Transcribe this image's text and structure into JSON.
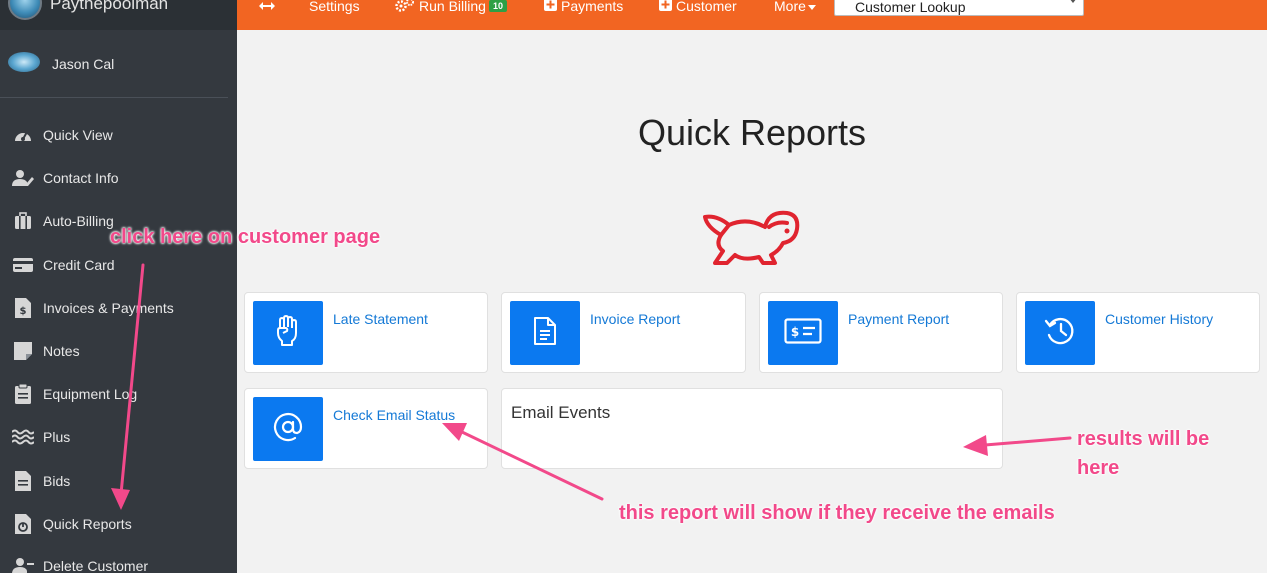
{
  "brand": {
    "name": "Paythepoolman"
  },
  "user": {
    "name": "Jason Cal"
  },
  "sidebar": {
    "items": [
      {
        "label": "Quick View",
        "icon": "gauge-icon"
      },
      {
        "label": "Contact Info",
        "icon": "user-edit-icon"
      },
      {
        "label": "Auto-Billing",
        "icon": "suitcase-icon"
      },
      {
        "label": "Credit Card",
        "icon": "credit-card-icon"
      },
      {
        "label": "Invoices & Payments",
        "icon": "invoice-dollar-icon"
      },
      {
        "label": "Notes",
        "icon": "note-icon"
      },
      {
        "label": "Equipment Log",
        "icon": "clipboard-icon"
      },
      {
        "label": "Plus",
        "icon": "water-icon"
      },
      {
        "label": "Bids",
        "icon": "file-icon"
      },
      {
        "label": "Quick Reports",
        "icon": "report-icon"
      },
      {
        "label": "Delete Customer",
        "icon": "user-remove-icon"
      }
    ]
  },
  "topbar": {
    "settings": "Settings",
    "run_billing": "Run Billing",
    "run_billing_badge": "10",
    "payments": "Payments",
    "customer": "Customer",
    "more": "More",
    "lookup": "Customer Lookup"
  },
  "main": {
    "title": "Quick Reports",
    "reports": [
      {
        "label": "Late Statement",
        "icon": "raised-fist-icon"
      },
      {
        "label": "Invoice Report",
        "icon": "document-icon"
      },
      {
        "label": "Payment Report",
        "icon": "check-dollar-icon"
      },
      {
        "label": "Customer History",
        "icon": "history-icon"
      },
      {
        "label": "Check Email Status",
        "icon": "at-sign-icon"
      }
    ],
    "events_title": "Email Events"
  },
  "annotations": {
    "click_here": "click here on customer page",
    "results_line1": "results will be",
    "results_line2": "here",
    "report_info": "this report will show if they receive the emails"
  },
  "colors": {
    "accent": "#f26522",
    "tile": "#0b79f0",
    "link": "#1479d6",
    "annotation": "#f2498a",
    "sidebar": "#34393f",
    "rabbit": "#e0242f"
  }
}
